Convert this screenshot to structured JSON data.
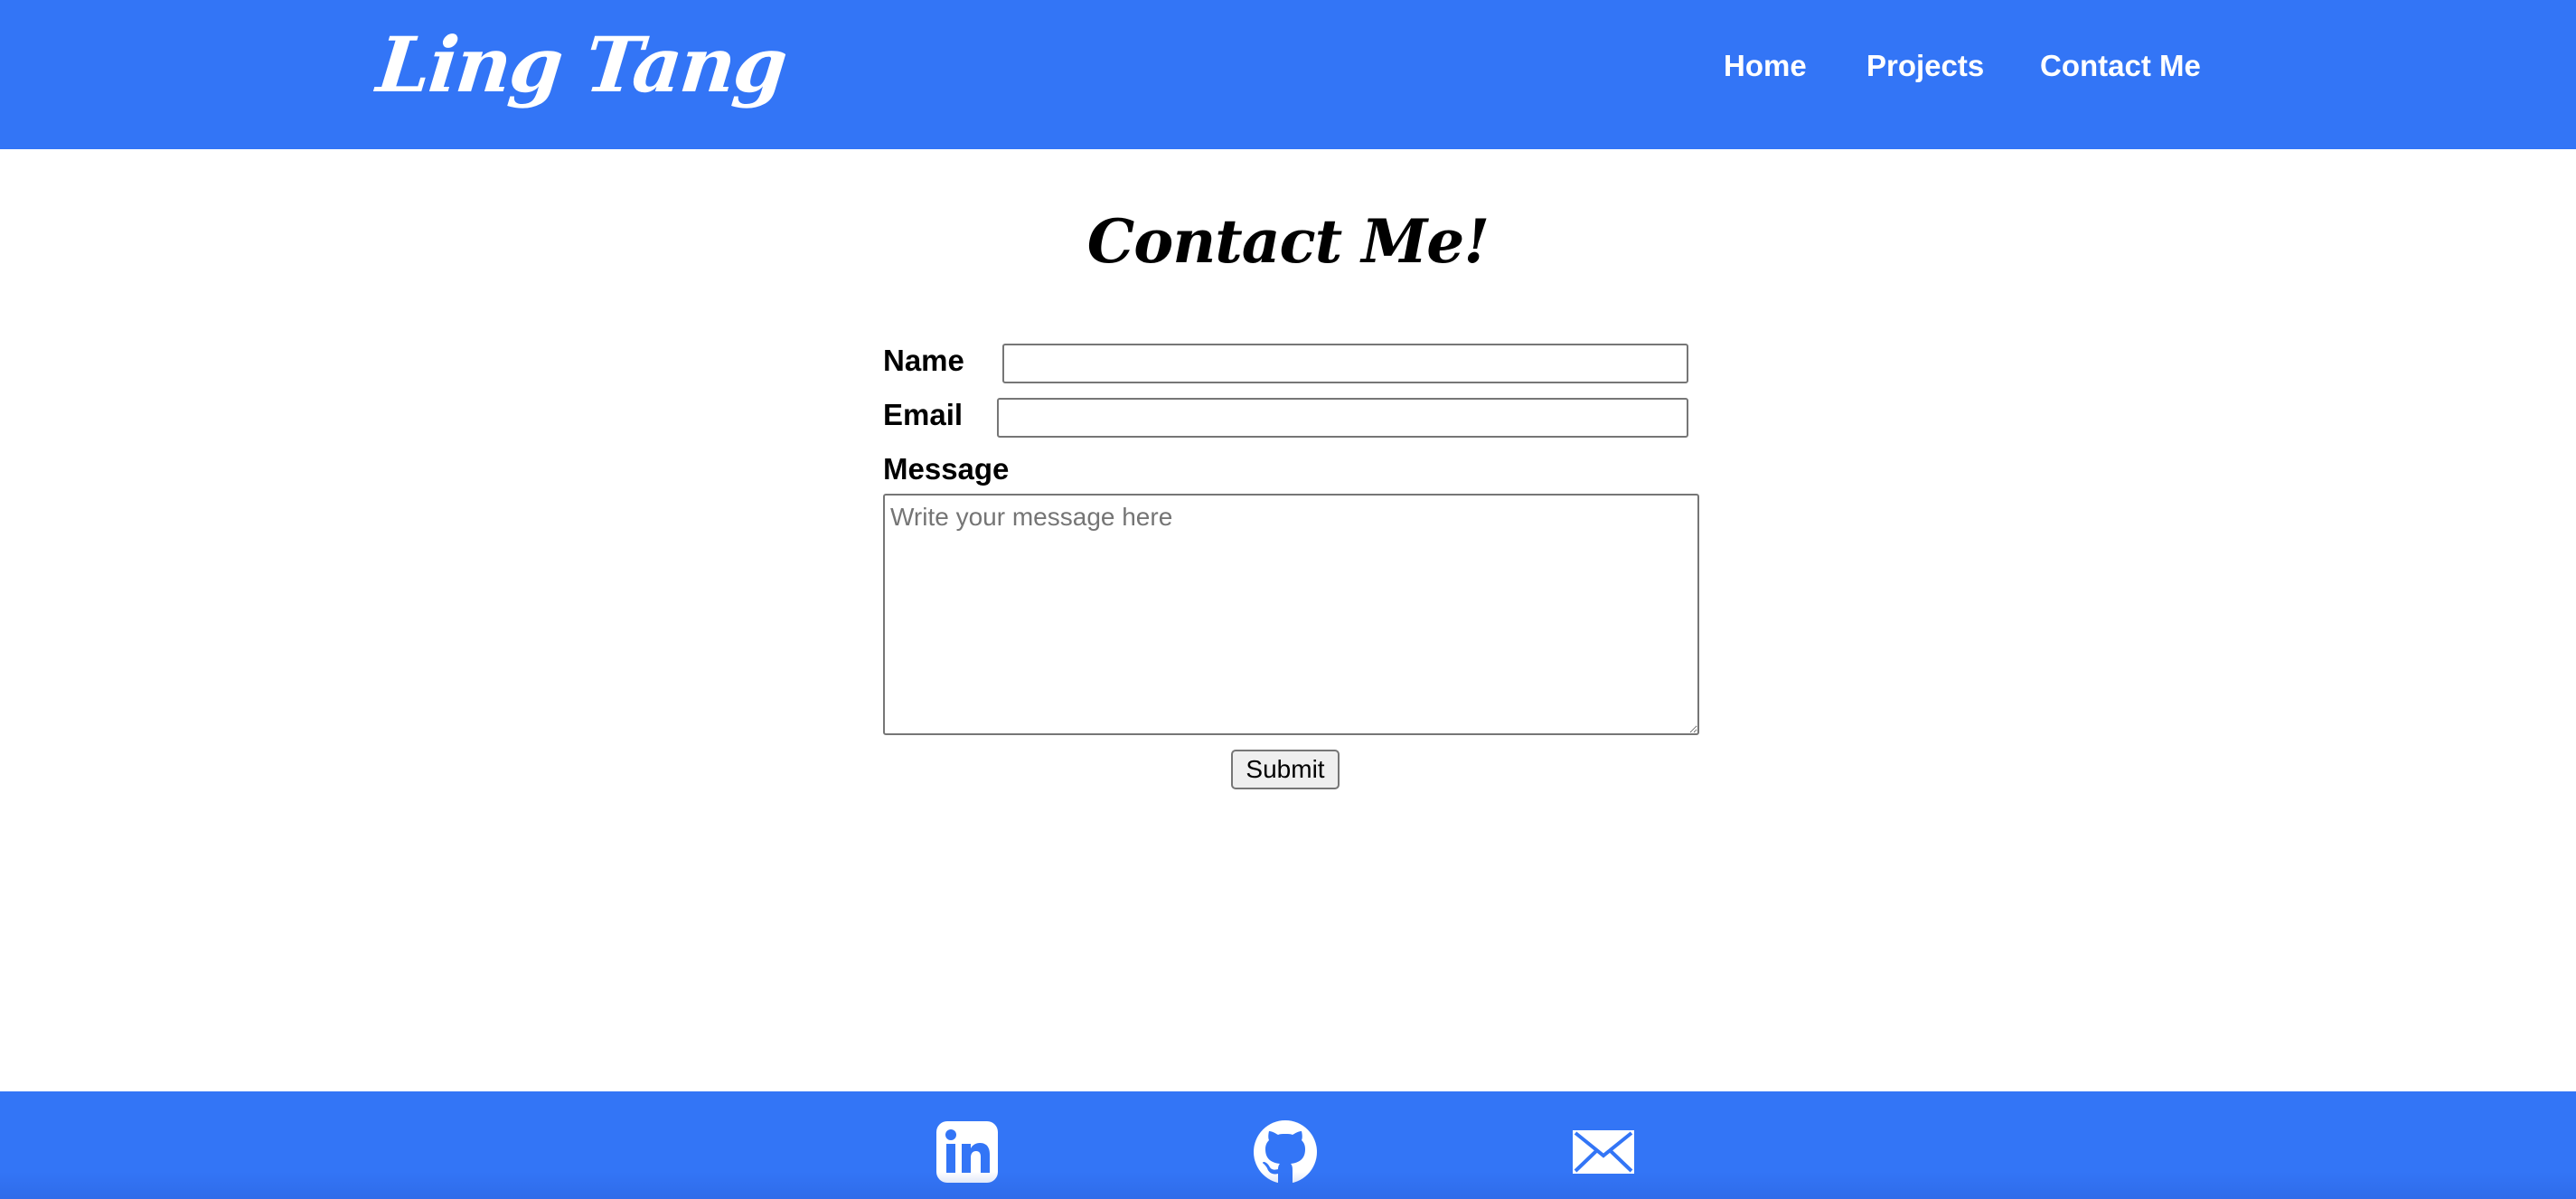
{
  "header": {
    "logo": "Ling Tang",
    "nav": [
      {
        "label": "Home"
      },
      {
        "label": "Projects"
      },
      {
        "label": "Contact Me"
      }
    ],
    "background_color": "#3375f6"
  },
  "main": {
    "title": "Contact Me!",
    "form": {
      "name_label": "Name",
      "name_value": "",
      "email_label": "Email",
      "email_value": "",
      "message_label": "Message",
      "message_placeholder": "Write your message here",
      "submit_label": "Submit"
    }
  },
  "footer": {
    "icons": [
      {
        "name": "linkedin-icon"
      },
      {
        "name": "github-icon"
      },
      {
        "name": "mail-icon"
      }
    ],
    "background_color": "#3375f6"
  }
}
